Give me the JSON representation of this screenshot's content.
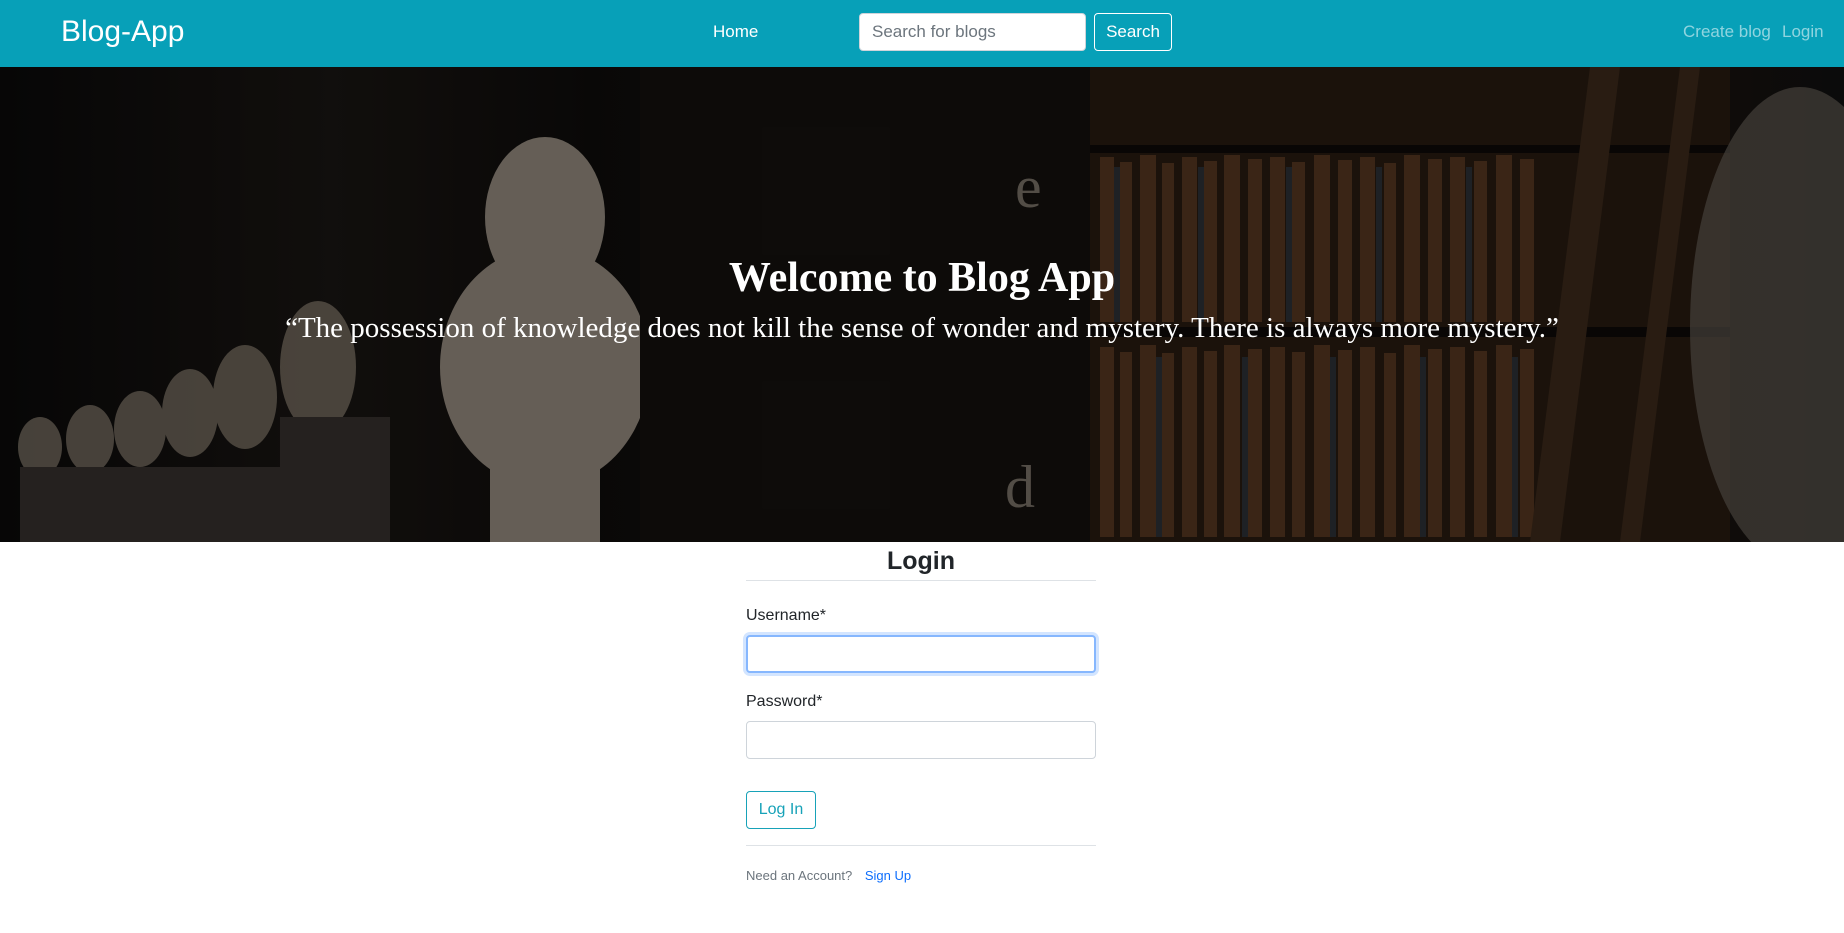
{
  "navbar": {
    "brand": "Blog-App",
    "home_label": "Home",
    "search_placeholder": "Search for blogs",
    "search_button": "Search",
    "create_blog_label": "Create blog",
    "login_label": "Login"
  },
  "hero": {
    "title": "Welcome to Blog App",
    "quote": "“The possession of knowledge does not kill the sense of wonder and mystery. There is always more mystery.”"
  },
  "login_form": {
    "title": "Login",
    "username_label": "Username*",
    "username_value": "",
    "password_label": "Password*",
    "password_value": "",
    "submit_label": "Log In",
    "footer_text": "Need an Account?",
    "signup_label": "Sign Up"
  },
  "colors": {
    "navbar_bg": "#07a0b8",
    "accent": "#17a2b8",
    "link": "#0d6efd"
  }
}
